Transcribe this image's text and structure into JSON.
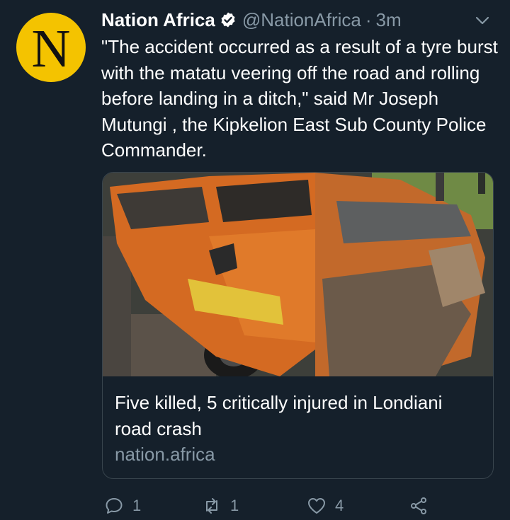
{
  "account": {
    "display_name": "Nation Africa",
    "handle": "@NationAfrica",
    "separator": "·",
    "time": "3m",
    "avatar_letter": "N",
    "avatar_color": "#f4c300",
    "verified_icon": "verified-badge-icon"
  },
  "tweet": {
    "text": "\"The accident occurred as a result of a tyre burst with the matatu veering off the road and rolling before landing in a ditch,\" said Mr Joseph Mutungi , the Kipkelion East Sub County Police Commander."
  },
  "card": {
    "title": "Five killed, 5 critically injured in Londiani road crash",
    "domain": "nation.africa",
    "image_icon": "crashed-matatu-photo"
  },
  "actions": {
    "reply_count": "1",
    "retweet_count": "1",
    "like_count": "4"
  },
  "colors": {
    "background": "#15202b",
    "muted_text": "#8899a6",
    "border": "#38444d"
  }
}
